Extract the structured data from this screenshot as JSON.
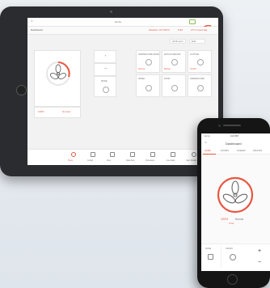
{
  "tablet": {
    "header_title": "Home",
    "section_title": "Dashboard",
    "status_items": [
      "Weather 12°C/54°F",
      "5:30",
      "27°C Good day"
    ],
    "filter_labels": [
      "All Rooms",
      "Edit"
    ],
    "fan": {
      "level_label": "100%",
      "mode_label": "Normal"
    },
    "tiles": [
      {
        "label": "TEMPERATURE SENSOR",
        "value": "Normal"
      },
      {
        "label": "MOTION SENSOR",
        "value": "Motion"
      },
      {
        "label": "LIGHTING",
        "value": "On/Off"
      },
      {
        "label": "SPEED",
        "value": ""
      },
      {
        "label": "DOOR",
        "value": ""
      },
      {
        "label": "TEMPERATURE",
        "value": ""
      },
      {
        "label": "TEMPERATURE",
        "value": ""
      }
    ],
    "side_controls": {
      "plus": "+",
      "minus": "−",
      "mode": "MODE"
    },
    "nav": [
      "Home",
      "Config",
      "Files",
      "Data Sets",
      "Schedules",
      "Live Data",
      "User Details"
    ]
  },
  "phone": {
    "status_left": "Carrier",
    "status_time": "4:21 PM",
    "title": "Dashboard",
    "tabs": [
      "HOME",
      "ROOMS",
      "SCENES",
      "DEVICES"
    ],
    "fan_level": "100%",
    "fan_mode": "Normal",
    "fan_sub": "Timer",
    "bottom_labels": [
      "MODE",
      "ON/OFF"
    ],
    "plus": "+",
    "minus": "−"
  },
  "colors": {
    "accent": "#e8553f",
    "tablet_bezel": "#2a2c30",
    "phone_bezel": "#151515"
  }
}
